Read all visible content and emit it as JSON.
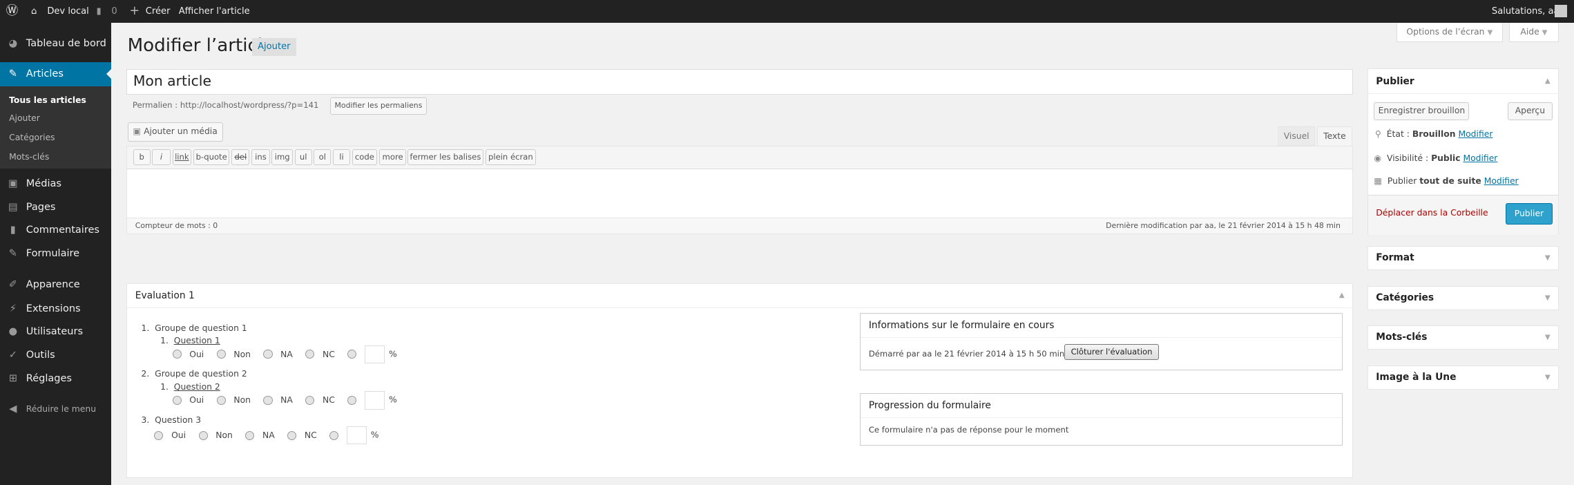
{
  "adminbar": {
    "site": "Dev local",
    "comments": "0",
    "create": "Créer",
    "view": "Afficher l'article",
    "greeting": "Salutations, aa"
  },
  "sidebar": {
    "items": [
      {
        "label": "Tableau de bord",
        "icon": "dashboard-icon"
      },
      {
        "label": "Articles",
        "icon": "pin-icon"
      },
      {
        "label": "Médias",
        "icon": "media-icon"
      },
      {
        "label": "Pages",
        "icon": "pages-icon"
      },
      {
        "label": "Commentaires",
        "icon": "comments-icon"
      },
      {
        "label": "Formulaire",
        "icon": "pin-icon"
      },
      {
        "label": "Apparence",
        "icon": "brush-icon"
      },
      {
        "label": "Extensions",
        "icon": "plugin-icon"
      },
      {
        "label": "Utilisateurs",
        "icon": "user-icon"
      },
      {
        "label": "Outils",
        "icon": "wrench-icon"
      },
      {
        "label": "Réglages",
        "icon": "settings-icon"
      }
    ],
    "submenu": [
      "Tous les articles",
      "Ajouter",
      "Catégories",
      "Mots-clés"
    ],
    "collapse": "Réduire le menu"
  },
  "header": {
    "title": "Modifier l’article",
    "add": "Ajouter",
    "screen_options": "Options de l’écran",
    "help": "Aide"
  },
  "editor": {
    "title_value": "Mon article",
    "permalink_label": "Permalien :",
    "permalink_url": "http://localhost/wordpress/?p=141",
    "edit_permalink": "Modifier les permaliens",
    "add_media": "Ajouter un média",
    "tab_visual": "Visuel",
    "tab_text": "Texte",
    "quicktags": [
      "b",
      "i",
      "link",
      "b-quote",
      "del",
      "ins",
      "img",
      "ul",
      "ol",
      "li",
      "code",
      "more",
      "fermer les balises",
      "plein écran"
    ],
    "word_count": "Compteur de mots : 0",
    "last_edit": "Dernière modification par aa, le 21 février 2014 à 15 h 48 min"
  },
  "evaluation": {
    "title": "Evaluation 1",
    "groups": [
      {
        "num": "1.",
        "label": "Groupe de question 1",
        "q_num": "1.",
        "question": "Question 1"
      },
      {
        "num": "2.",
        "label": "Groupe de question 2",
        "q_num": "1.",
        "question": "Question 2"
      }
    ],
    "q3": {
      "num": "3.",
      "label": "Question 3"
    },
    "options": [
      "Oui",
      "Non",
      "NA",
      "NC"
    ],
    "percent": "%",
    "info": {
      "title": "Informations sur le formulaire en cours",
      "started": "Démarré par aa le 21 février 2014 à 15 h 50 min",
      "close_button": "Clôturer l'évaluation"
    },
    "progress": {
      "title": "Progression du formulaire",
      "text": "Ce formulaire n'a pas de réponse pour le moment"
    }
  },
  "publish": {
    "title": "Publier",
    "save_draft": "Enregistrer brouillon",
    "preview": "Aperçu",
    "status_label": "État :",
    "status_value": "Brouillon",
    "visibility_label": "Visibilité :",
    "visibility_value": "Public",
    "schedule_label": "Publier",
    "schedule_value": "tout de suite",
    "edit": "Modifier",
    "trash": "Déplacer dans la Corbeille",
    "publish_button": "Publier"
  },
  "boxes": [
    "Format",
    "Catégories",
    "Mots-clés",
    "Image à la Une"
  ],
  "colors": {
    "accent": "#0074a2",
    "publish": "#2ea2cc",
    "trash": "#a00",
    "adminbar": "#222"
  }
}
